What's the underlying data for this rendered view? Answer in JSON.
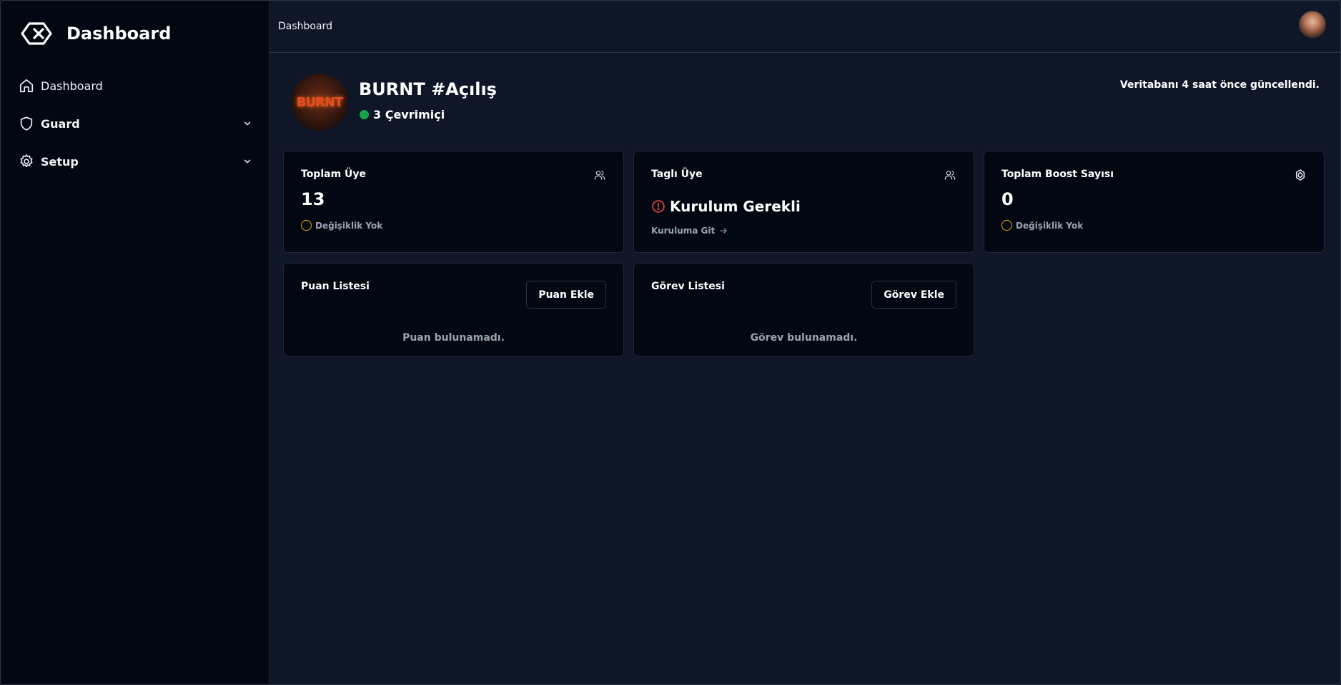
{
  "sidebar": {
    "brand_title": "Dashboard",
    "items": [
      {
        "label": "Dashboard",
        "icon": "home-icon"
      },
      {
        "label": "Guard",
        "icon": "shield-icon"
      },
      {
        "label": "Setup",
        "icon": "gear-icon"
      }
    ]
  },
  "topbar": {
    "breadcrumb": "Dashboard"
  },
  "server": {
    "name": "BURNT #Açılış",
    "online": "3 Çevrimiçi",
    "logo_text": "BURNT",
    "db_updated": "Veritabanı 4 saat önce güncellendi."
  },
  "stats": {
    "total_members": {
      "title": "Toplam Üye",
      "value": "13",
      "change": "Değişiklik Yok"
    },
    "tagged_members": {
      "title": "Taglı Üye",
      "warning": "Kurulum Gerekli",
      "link": "Kuruluma Git"
    },
    "boosts": {
      "title": "Toplam Boost Sayısı",
      "value": "0",
      "change": "Değişiklik Yok"
    }
  },
  "points": {
    "title": "Puan Listesi",
    "button": "Puan Ekle",
    "empty": "Puan bulunamadı."
  },
  "tasks": {
    "title": "Görev Listesi",
    "button": "Görev Ekle",
    "empty": "Görev bulunamadı."
  },
  "colors": {
    "online": "#16a34a",
    "warning": "#ef4444",
    "neutral_ring": "#eab308"
  }
}
